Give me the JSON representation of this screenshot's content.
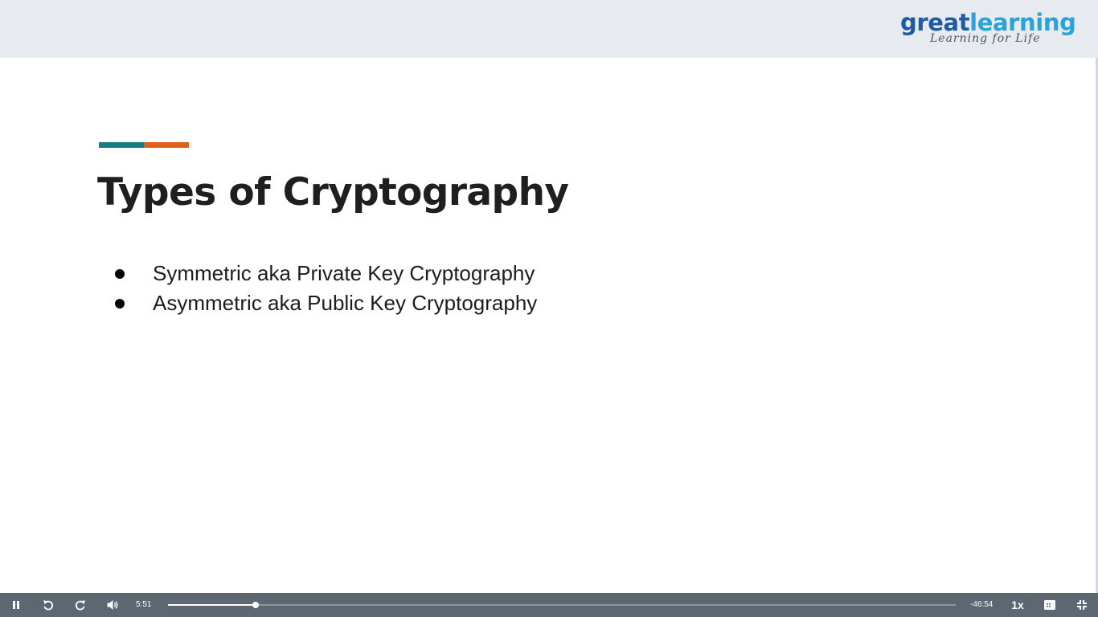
{
  "slide": {
    "logo": {
      "brand_part1": "great",
      "brand_part2": "learning",
      "tagline": "Learning for Life"
    },
    "title": "Types of Cryptography",
    "bullets": [
      {
        "text": "Symmetric aka Private Key Cryptography"
      },
      {
        "text": "Asymmetric aka Public Key Cryptography"
      }
    ],
    "colors": {
      "accent_teal": "#167d84",
      "accent_orange": "#e0601a",
      "header_bg": "#e7ebef"
    }
  },
  "player": {
    "icons": {
      "pause": "pause-icon",
      "rewind": "rewind-icon",
      "forward": "forward-icon",
      "volume": "volume-icon",
      "captions": "hd-icon",
      "exit_fullscreen": "exit-fullscreen-icon"
    },
    "elapsed": "5:51",
    "remaining": "-46:54",
    "progress_fraction": 0.111,
    "speed_label": "1x",
    "colors": {
      "bar_bg": "#5d6772"
    }
  }
}
